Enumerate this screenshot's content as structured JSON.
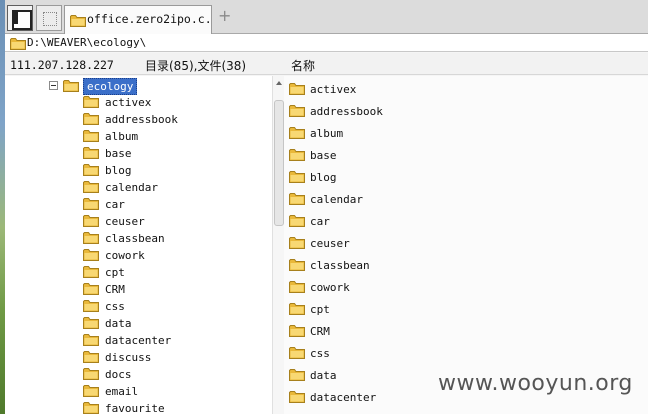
{
  "tab": {
    "title": "office.zero2ipo.c..."
  },
  "address": {
    "path": "D:\\WEAVER\\ecology\\"
  },
  "status": {
    "ip": "111.207.128.227",
    "counts": "目录(85),文件(38)",
    "name_header": "名称"
  },
  "tree": {
    "root": "ecology",
    "children": [
      "activex",
      "addressbook",
      "album",
      "base",
      "blog",
      "calendar",
      "car",
      "ceuser",
      "classbean",
      "cowork",
      "cpt",
      "CRM",
      "css",
      "data",
      "datacenter",
      "discuss",
      "docs",
      "email",
      "favourite"
    ]
  },
  "list": {
    "items": [
      "activex",
      "addressbook",
      "album",
      "base",
      "blog",
      "calendar",
      "car",
      "ceuser",
      "classbean",
      "cowork",
      "cpt",
      "CRM",
      "css",
      "data",
      "datacenter"
    ]
  },
  "watermark": "www.wooyun.org",
  "colors": {
    "selection": "#3b6fc9",
    "folder": "#f2c84b"
  }
}
